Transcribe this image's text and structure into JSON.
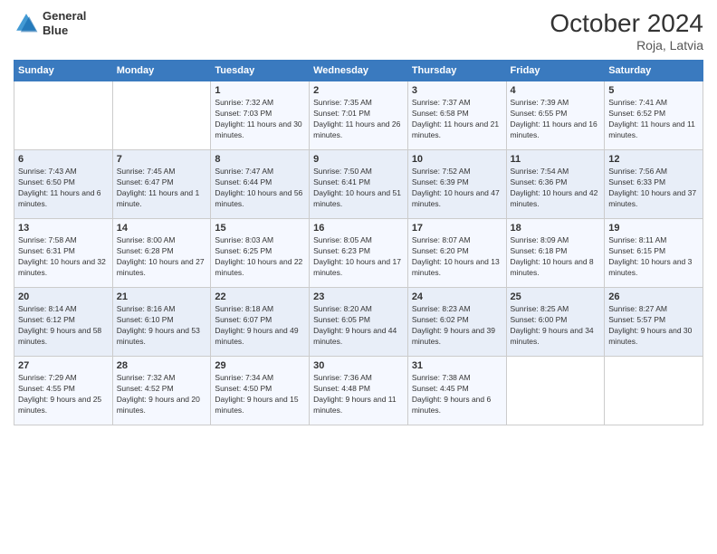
{
  "header": {
    "logo_line1": "General",
    "logo_line2": "Blue",
    "month": "October 2024",
    "location": "Roja, Latvia"
  },
  "days_of_week": [
    "Sunday",
    "Monday",
    "Tuesday",
    "Wednesday",
    "Thursday",
    "Friday",
    "Saturday"
  ],
  "weeks": [
    [
      {
        "day": "",
        "text": ""
      },
      {
        "day": "",
        "text": ""
      },
      {
        "day": "1",
        "text": "Sunrise: 7:32 AM\nSunset: 7:03 PM\nDaylight: 11 hours and 30 minutes."
      },
      {
        "day": "2",
        "text": "Sunrise: 7:35 AM\nSunset: 7:01 PM\nDaylight: 11 hours and 26 minutes."
      },
      {
        "day": "3",
        "text": "Sunrise: 7:37 AM\nSunset: 6:58 PM\nDaylight: 11 hours and 21 minutes."
      },
      {
        "day": "4",
        "text": "Sunrise: 7:39 AM\nSunset: 6:55 PM\nDaylight: 11 hours and 16 minutes."
      },
      {
        "day": "5",
        "text": "Sunrise: 7:41 AM\nSunset: 6:52 PM\nDaylight: 11 hours and 11 minutes."
      }
    ],
    [
      {
        "day": "6",
        "text": "Sunrise: 7:43 AM\nSunset: 6:50 PM\nDaylight: 11 hours and 6 minutes."
      },
      {
        "day": "7",
        "text": "Sunrise: 7:45 AM\nSunset: 6:47 PM\nDaylight: 11 hours and 1 minute."
      },
      {
        "day": "8",
        "text": "Sunrise: 7:47 AM\nSunset: 6:44 PM\nDaylight: 10 hours and 56 minutes."
      },
      {
        "day": "9",
        "text": "Sunrise: 7:50 AM\nSunset: 6:41 PM\nDaylight: 10 hours and 51 minutes."
      },
      {
        "day": "10",
        "text": "Sunrise: 7:52 AM\nSunset: 6:39 PM\nDaylight: 10 hours and 47 minutes."
      },
      {
        "day": "11",
        "text": "Sunrise: 7:54 AM\nSunset: 6:36 PM\nDaylight: 10 hours and 42 minutes."
      },
      {
        "day": "12",
        "text": "Sunrise: 7:56 AM\nSunset: 6:33 PM\nDaylight: 10 hours and 37 minutes."
      }
    ],
    [
      {
        "day": "13",
        "text": "Sunrise: 7:58 AM\nSunset: 6:31 PM\nDaylight: 10 hours and 32 minutes."
      },
      {
        "day": "14",
        "text": "Sunrise: 8:00 AM\nSunset: 6:28 PM\nDaylight: 10 hours and 27 minutes."
      },
      {
        "day": "15",
        "text": "Sunrise: 8:03 AM\nSunset: 6:25 PM\nDaylight: 10 hours and 22 minutes."
      },
      {
        "day": "16",
        "text": "Sunrise: 8:05 AM\nSunset: 6:23 PM\nDaylight: 10 hours and 17 minutes."
      },
      {
        "day": "17",
        "text": "Sunrise: 8:07 AM\nSunset: 6:20 PM\nDaylight: 10 hours and 13 minutes."
      },
      {
        "day": "18",
        "text": "Sunrise: 8:09 AM\nSunset: 6:18 PM\nDaylight: 10 hours and 8 minutes."
      },
      {
        "day": "19",
        "text": "Sunrise: 8:11 AM\nSunset: 6:15 PM\nDaylight: 10 hours and 3 minutes."
      }
    ],
    [
      {
        "day": "20",
        "text": "Sunrise: 8:14 AM\nSunset: 6:12 PM\nDaylight: 9 hours and 58 minutes."
      },
      {
        "day": "21",
        "text": "Sunrise: 8:16 AM\nSunset: 6:10 PM\nDaylight: 9 hours and 53 minutes."
      },
      {
        "day": "22",
        "text": "Sunrise: 8:18 AM\nSunset: 6:07 PM\nDaylight: 9 hours and 49 minutes."
      },
      {
        "day": "23",
        "text": "Sunrise: 8:20 AM\nSunset: 6:05 PM\nDaylight: 9 hours and 44 minutes."
      },
      {
        "day": "24",
        "text": "Sunrise: 8:23 AM\nSunset: 6:02 PM\nDaylight: 9 hours and 39 minutes."
      },
      {
        "day": "25",
        "text": "Sunrise: 8:25 AM\nSunset: 6:00 PM\nDaylight: 9 hours and 34 minutes."
      },
      {
        "day": "26",
        "text": "Sunrise: 8:27 AM\nSunset: 5:57 PM\nDaylight: 9 hours and 30 minutes."
      }
    ],
    [
      {
        "day": "27",
        "text": "Sunrise: 7:29 AM\nSunset: 4:55 PM\nDaylight: 9 hours and 25 minutes."
      },
      {
        "day": "28",
        "text": "Sunrise: 7:32 AM\nSunset: 4:52 PM\nDaylight: 9 hours and 20 minutes."
      },
      {
        "day": "29",
        "text": "Sunrise: 7:34 AM\nSunset: 4:50 PM\nDaylight: 9 hours and 15 minutes."
      },
      {
        "day": "30",
        "text": "Sunrise: 7:36 AM\nSunset: 4:48 PM\nDaylight: 9 hours and 11 minutes."
      },
      {
        "day": "31",
        "text": "Sunrise: 7:38 AM\nSunset: 4:45 PM\nDaylight: 9 hours and 6 minutes."
      },
      {
        "day": "",
        "text": ""
      },
      {
        "day": "",
        "text": ""
      }
    ]
  ]
}
